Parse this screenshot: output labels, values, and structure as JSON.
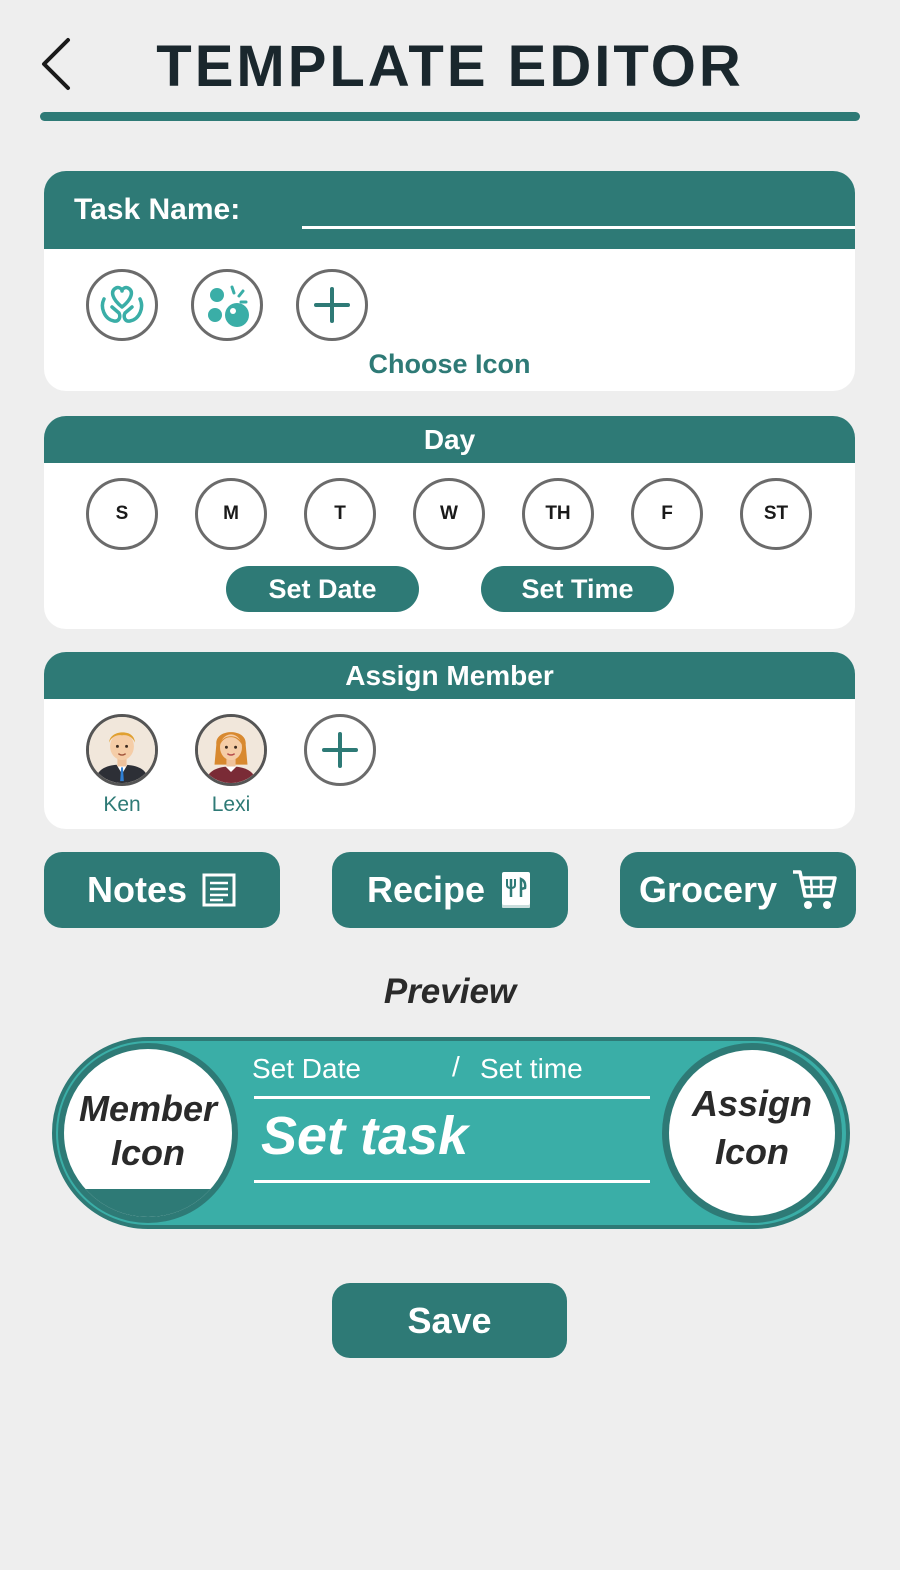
{
  "header": {
    "title": "TEMPLATE EDITOR",
    "back_icon": "chevron-left-icon"
  },
  "task_card": {
    "label": "Task Name:",
    "value": "",
    "icons": [
      {
        "name": "hands-heart-icon"
      },
      {
        "name": "dots-bubbles-icon"
      },
      {
        "name": "plus-icon"
      }
    ],
    "choose_icon_label": "Choose Icon"
  },
  "day_card": {
    "header": "Day",
    "days": [
      "S",
      "M",
      "T",
      "W",
      "TH",
      "F",
      "ST"
    ],
    "set_date_label": "Set Date",
    "set_time_label": "Set Time"
  },
  "member_card": {
    "header": "Assign Member",
    "members": [
      {
        "name": "Ken"
      },
      {
        "name": "Lexi"
      }
    ],
    "add_icon": "plus-icon"
  },
  "actions": {
    "notes_label": "Notes",
    "recipe_label": "Recipe",
    "grocery_label": "Grocery"
  },
  "preview": {
    "label": "Preview",
    "date_text": "Set Date",
    "separator": "/",
    "time_text": "Set time",
    "task_text": "Set task",
    "member_icon_line1": "Member",
    "member_icon_line2": "Icon",
    "assign_icon_line1": "Assign",
    "assign_icon_line2": "Icon"
  },
  "save_label": "Save",
  "colors": {
    "primary": "#2e7a76",
    "preview_fill": "#3aaea7",
    "background": "#eeeeee",
    "title_text": "#1a272d"
  }
}
